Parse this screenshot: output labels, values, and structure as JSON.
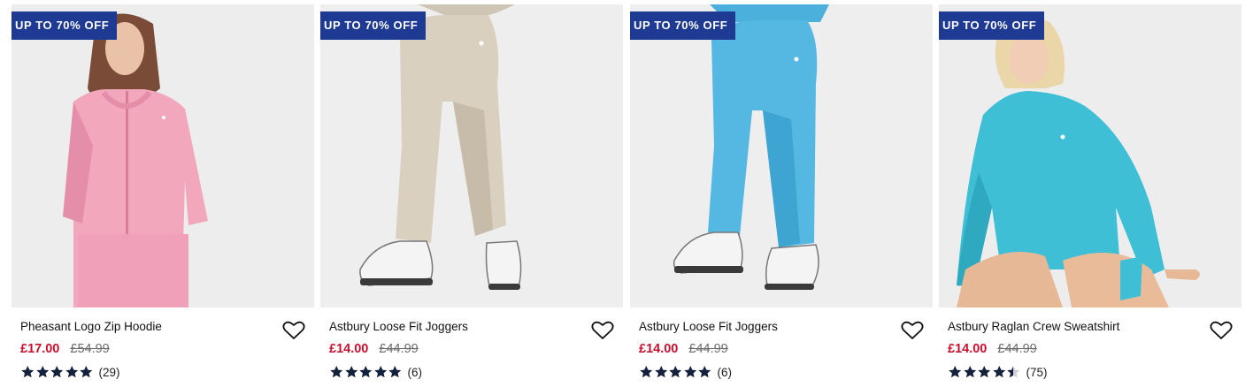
{
  "products": [
    {
      "badge": "UP TO 70% OFF",
      "name": "Pheasant Logo Zip Hoodie",
      "price": "£17.00",
      "was_price": "£54.99",
      "rating": 5,
      "review_count": "(29)",
      "image_subject": "pink-zip-hoodie",
      "colors": {
        "garment": "#f2a7bd",
        "garment_shade": "#e58ea9",
        "backdrop": "#ededed"
      }
    },
    {
      "badge": "UP TO 70% OFF",
      "name": "Astbury Loose Fit Joggers",
      "price": "£14.00",
      "was_price": "£44.99",
      "rating": 5,
      "review_count": "(6)",
      "image_subject": "beige-joggers",
      "colors": {
        "garment": "#d9d0c0",
        "garment_shade": "#c7bca9",
        "backdrop": "#eeeeee"
      }
    },
    {
      "badge": "UP TO 70% OFF",
      "name": "Astbury Loose Fit Joggers",
      "price": "£14.00",
      "was_price": "£44.99",
      "rating": 5,
      "review_count": "(6)",
      "image_subject": "blue-joggers",
      "colors": {
        "garment": "#55b8e3",
        "garment_shade": "#3ea4d2",
        "backdrop": "#eeeeee"
      }
    },
    {
      "badge": "UP TO 70% OFF",
      "name": "Astbury Raglan Crew Sweatshirt",
      "price": "£14.00",
      "was_price": "£44.99",
      "rating": 4.5,
      "review_count": "(75)",
      "image_subject": "turquoise-sweatshirt",
      "colors": {
        "garment": "#3fbfd6",
        "garment_shade": "#2fa9c0",
        "backdrop": "#ededed"
      }
    }
  ],
  "theme": {
    "badge_bg": "#1f3a93",
    "sale_price": "#c8102e",
    "star_fill": "#14213d"
  }
}
